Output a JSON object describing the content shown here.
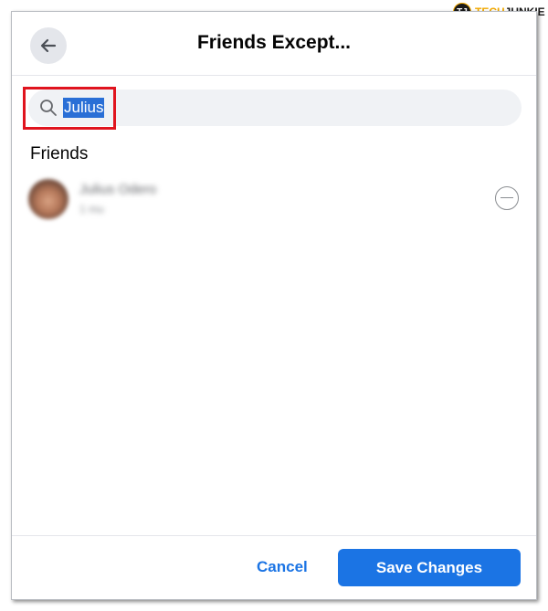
{
  "header": {
    "title": "Friends Except..."
  },
  "search": {
    "value": "Julius"
  },
  "section": {
    "title": "Friends"
  },
  "friends": [
    {
      "name": "Julius Odero",
      "subtitle": "1 mu"
    }
  ],
  "footer": {
    "cancel_label": "Cancel",
    "save_label": "Save Changes"
  },
  "watermark": {
    "badge": "TJ",
    "tech": "TECH",
    "junkie": "JUNKIE"
  },
  "colors": {
    "primary": "#1b74e4",
    "highlight_border": "#e0141e",
    "selection": "#2a6fd6"
  }
}
